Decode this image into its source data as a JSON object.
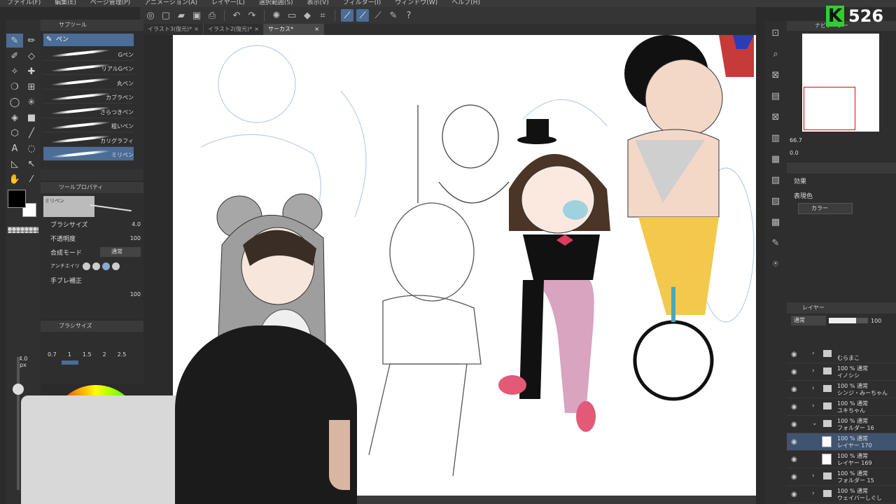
{
  "menubar": [
    "ファイル(F)",
    "編集(E)",
    "ページ管理(P)",
    "アニメーション(A)",
    "レイヤー(L)",
    "選択範囲(S)",
    "表示(V)",
    "フィルター(I)",
    "ウィンドウ(W)",
    "ヘルプ(H)"
  ],
  "tabs": [
    {
      "label": "イラスト3(復元)*",
      "close": "×"
    },
    {
      "label": "イラスト2(復元)*",
      "close": "×"
    },
    {
      "label": "サーカス*",
      "close": "×"
    }
  ],
  "subtool": {
    "title": "サブツール",
    "active": "ペン",
    "brushes": [
      "Gペン",
      "リアルGペン",
      "丸ペン",
      "カブラペン",
      "さらつきペン",
      "粗いペン",
      "カリグラフィ",
      "ミリペン"
    ]
  },
  "toolprop": {
    "title": "ツールプロパティ",
    "preview_label": "ミリペン",
    "brush_size_label": "ブラシサイズ",
    "brush_size_value": "4.0",
    "opacity_label": "不透明度",
    "opacity_value": "100",
    "blend_label": "合成モード",
    "blend_value": "通常",
    "aa_label": "アンチエイリアス",
    "stabilizer_label": "手ブレ補正",
    "stabilizer_value": "100"
  },
  "brushsize": {
    "title": "ブラシサイズ",
    "values": [
      "0.7",
      "1",
      "1.5",
      "2",
      "2.5"
    ]
  },
  "left": {
    "size_readout": "4.0",
    "size_unit": "px"
  },
  "navigator": {
    "title": "ナビゲーター",
    "zoom": "66.7",
    "rotation": "0.0"
  },
  "brand": {
    "letter": "K",
    "number": "526"
  },
  "effect": {
    "title": "効果",
    "color_label": "表現色",
    "color_value": "カラー"
  },
  "layers": {
    "title": "レイヤー",
    "blend": "通常",
    "opacity": "100",
    "rows": [
      {
        "top": "",
        "name": "むらまこ",
        "type": "folder",
        "open": false,
        "selected": false
      },
      {
        "top": "100 % 通常",
        "name": "イノシシ",
        "type": "folder",
        "open": false,
        "selected": false
      },
      {
        "top": "100 % 通常",
        "name": "シンジ・みーちゃん",
        "type": "folder",
        "open": false,
        "selected": false
      },
      {
        "top": "100 % 通常",
        "name": "ユキちゃん",
        "type": "folder",
        "open": false,
        "selected": false
      },
      {
        "top": "100 % 通常",
        "name": "フォルダー 16",
        "type": "folder",
        "open": true,
        "selected": false
      },
      {
        "top": "100 % 通常",
        "name": "レイヤー 170",
        "type": "layer",
        "open": false,
        "selected": true
      },
      {
        "top": "100 % 通常",
        "name": "レイヤー 169",
        "type": "layer",
        "open": false,
        "selected": false
      },
      {
        "top": "100 % 通常",
        "name": "フォルダー 15",
        "type": "folder",
        "open": false,
        "selected": false
      },
      {
        "top": "100 % 通常",
        "name": "ウェイバーしぐし",
        "type": "folder",
        "open": false,
        "selected": false
      }
    ]
  }
}
